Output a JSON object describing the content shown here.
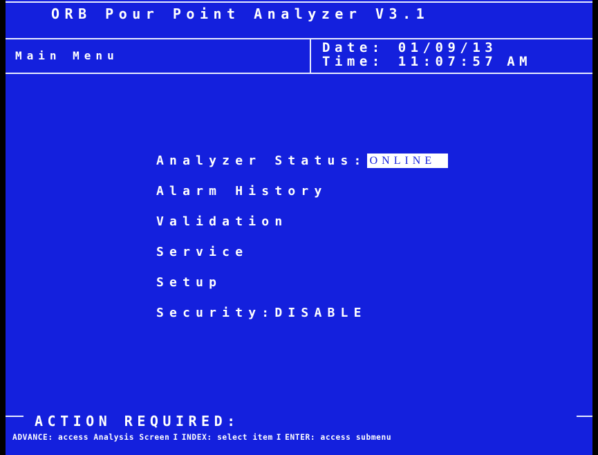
{
  "header": {
    "title": "ORB Pour Point Analyzer V3.1",
    "menu_name": "Main Menu",
    "date_label": "Date:",
    "date_value": "01/09/13",
    "time_label": "Time:",
    "time_value": "11:07:57",
    "time_ampm": "AM"
  },
  "menu": {
    "analyzer_status_label": "Analyzer Status:",
    "analyzer_status_value": "ONLINE",
    "alarm_history": "Alarm History",
    "validation": "Validation",
    "service": "Service",
    "setup": "Setup",
    "security_label": "Security:",
    "security_value": "DISABLE"
  },
  "footer": {
    "action_required": "ACTION REQUIRED:",
    "help_advance": "ADVANCE: access Analysis Screen",
    "help_separator": "I",
    "help_index": "INDEX: select item",
    "help_enter": "ENTER: access submenu"
  },
  "colors": {
    "screen_background": "#1420dd",
    "text": "#ffffff",
    "status_highlight": "#ffffff"
  }
}
